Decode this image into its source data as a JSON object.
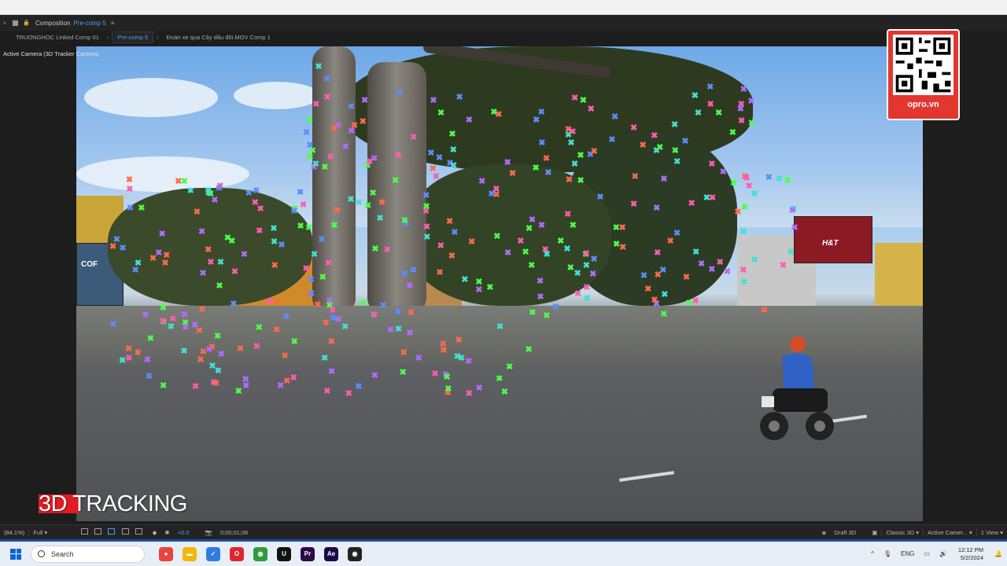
{
  "panel": {
    "close": "×",
    "composition_label": "Composition",
    "composition_name": "Pre-comp 5",
    "menu": "≡"
  },
  "tabs": [
    {
      "label": "TRUONGHOC Linked Comp 01"
    },
    {
      "label": "Pre-comp 5"
    },
    {
      "label": "Đoàn xe qua Cây dầu đôi.MOV Comp 1"
    }
  ],
  "viewer": {
    "camera_label": "Active Camera (3D Tracker Camera)",
    "overlay_title": "3D TRACKING",
    "badge_text": "opro.vn",
    "shop_sign": "H&T",
    "shop_sign_left": "COF"
  },
  "controls": {
    "zoom": "(84.1%)",
    "resolution": "Full",
    "exposure": "+0.0",
    "timecode": "0;00;01;06",
    "renderer": "Draft 3D",
    "renderer_mode": "Classic 3D",
    "camera": "Active Camer...",
    "views": "1 View"
  },
  "taskbar": {
    "search_placeholder": "Search",
    "language": "ENG",
    "time": "12:12 PM",
    "date": "5/2/2024",
    "apps": [
      {
        "icon": "chrome-icon",
        "color": "#e8453c",
        "glyph": "●"
      },
      {
        "icon": "folder-icon",
        "color": "#f2b705",
        "glyph": "▬"
      },
      {
        "icon": "check-icon",
        "color": "#2d7de0",
        "glyph": "✓"
      },
      {
        "icon": "opera-icon",
        "color": "#e0262d",
        "glyph": "O"
      },
      {
        "icon": "globe-icon",
        "color": "#2e9b3e",
        "glyph": "◍"
      },
      {
        "icon": "unreal-icon",
        "color": "#111111",
        "glyph": "U"
      },
      {
        "icon": "premiere-icon",
        "color": "#2a0a4a",
        "glyph": "Pr"
      },
      {
        "icon": "after-effects-icon",
        "color": "#1a0a4a",
        "glyph": "Ae"
      },
      {
        "icon": "obs-icon",
        "color": "#222222",
        "glyph": "◉"
      }
    ]
  },
  "colors": {
    "accent": "#4f9eef",
    "title_red": "#e01d25",
    "badge_red": "#e3362e"
  }
}
